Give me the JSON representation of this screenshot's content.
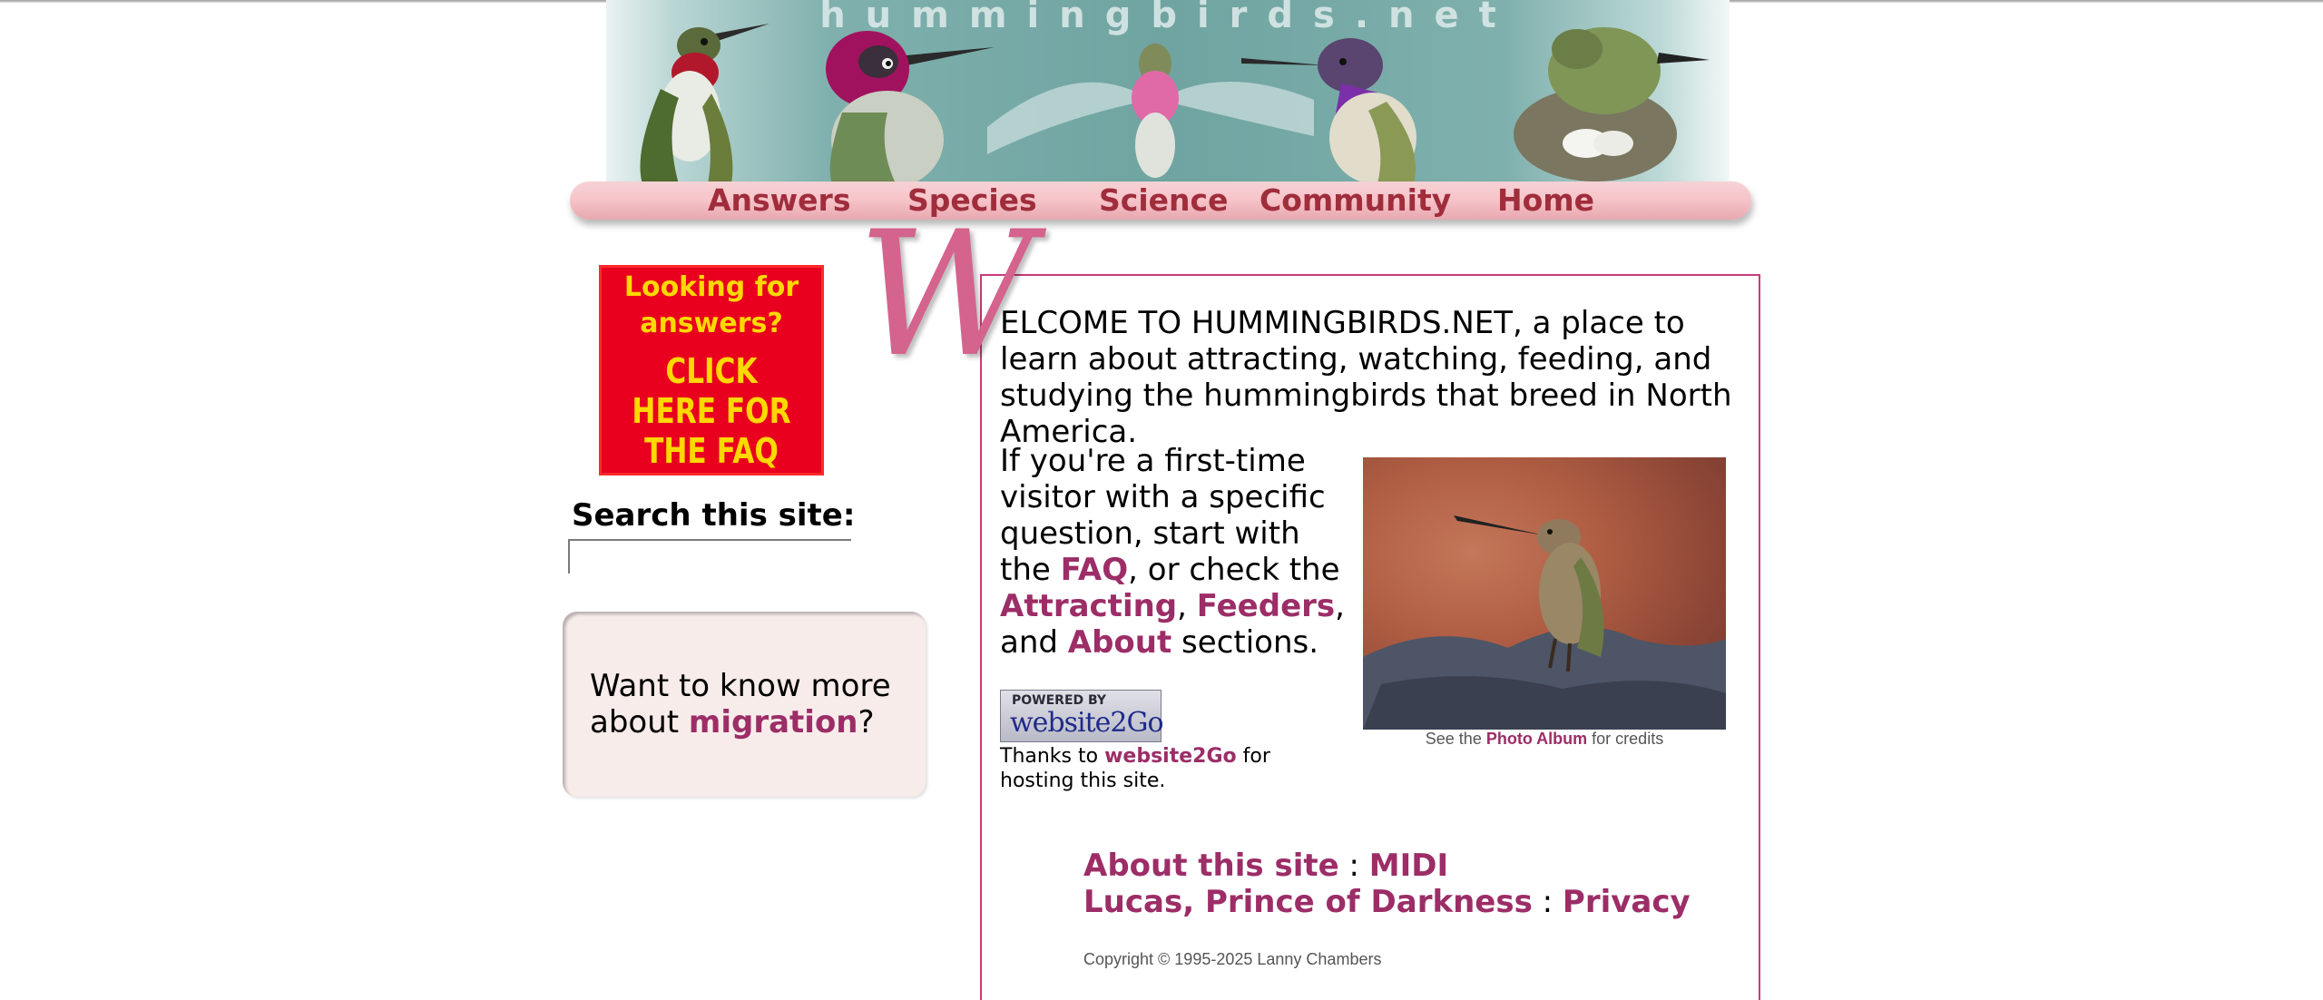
{
  "banner": {
    "title": "hummingbirds.net",
    "logo_alt": "hummingbirds banner"
  },
  "nav": {
    "items": [
      {
        "label": "Answers"
      },
      {
        "label": "Species"
      },
      {
        "label": "Science"
      },
      {
        "label": "Community"
      },
      {
        "label": "Home"
      }
    ],
    "color": "#a02d3c"
  },
  "sidebar": {
    "faq_badge": {
      "line1": "Looking for answers?",
      "line2": "CLICK HERE FOR THE FAQ"
    },
    "search": {
      "label": "Search this site:",
      "value": ""
    },
    "migration": {
      "prefix": "Want to know more about ",
      "link": "migration",
      "suffix": "?"
    }
  },
  "main": {
    "initial": "W",
    "welcome": "ELCOME TO HUMMINGBIRDS.NET, a place to learn about attracting, watching, feeding, and studying the hummingbirds that breed in North America.",
    "intro": {
      "part1": "If you're a first-time visitor with a specific question, start with the ",
      "faq_link": "FAQ",
      "part2": ", or check the ",
      "attracting_link": "Attracting",
      "sep1": ", ",
      "feeders_link": "Feeders",
      "part3": ", and ",
      "about_link": "About",
      "part4": " sections."
    },
    "hosting": {
      "logo_small": "POWERED BY",
      "logo_big": "website2Go",
      "prefix": "Thanks to ",
      "link": "website2Go",
      "suffix": " for hosting this site."
    },
    "photo_caption": {
      "prefix": "See the ",
      "link": "Photo Album",
      "suffix": " for credits"
    },
    "footer": {
      "about": "About this site",
      "sep": " : ",
      "midi": "MIDI",
      "lucas": "Lucas, Prince of Darkness",
      "privacy": "Privacy"
    },
    "copyright": "Copyright © 1995-2025 Lanny Chambers"
  },
  "colors": {
    "link": "#9c2d67",
    "accent_border": "#c73c78",
    "initial": "#d4638e"
  }
}
